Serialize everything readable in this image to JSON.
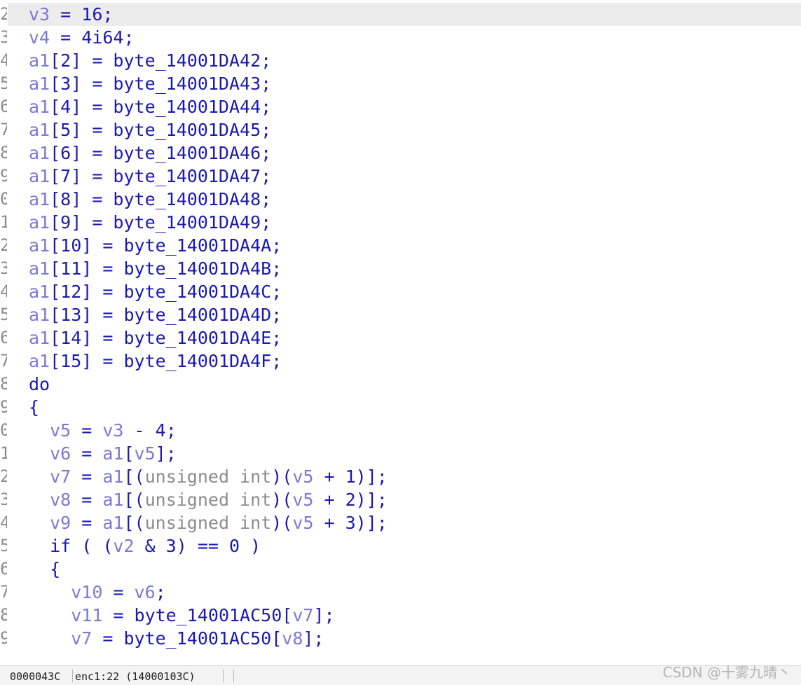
{
  "editor": {
    "lines": [
      {
        "num": "2",
        "tokens": [
          [
            "var",
            "v3"
          ],
          [
            "plain",
            " = 16;"
          ]
        ]
      },
      {
        "num": "3",
        "tokens": [
          [
            "var",
            "v4"
          ],
          [
            "plain",
            " = 4i64;"
          ]
        ]
      },
      {
        "num": "4",
        "tokens": [
          [
            "var",
            "a1"
          ],
          [
            "plain",
            "[2] = byte_14001DA42;"
          ]
        ]
      },
      {
        "num": "5",
        "tokens": [
          [
            "var",
            "a1"
          ],
          [
            "plain",
            "[3] = byte_14001DA43;"
          ]
        ]
      },
      {
        "num": "6",
        "tokens": [
          [
            "var",
            "a1"
          ],
          [
            "plain",
            "[4] = byte_14001DA44;"
          ]
        ]
      },
      {
        "num": "7",
        "tokens": [
          [
            "var",
            "a1"
          ],
          [
            "plain",
            "[5] = byte_14001DA45;"
          ]
        ]
      },
      {
        "num": "8",
        "tokens": [
          [
            "var",
            "a1"
          ],
          [
            "plain",
            "[6] = byte_14001DA46;"
          ]
        ]
      },
      {
        "num": "9",
        "tokens": [
          [
            "var",
            "a1"
          ],
          [
            "plain",
            "[7] = byte_14001DA47;"
          ]
        ]
      },
      {
        "num": "0",
        "tokens": [
          [
            "var",
            "a1"
          ],
          [
            "plain",
            "[8] = byte_14001DA48;"
          ]
        ]
      },
      {
        "num": "1",
        "tokens": [
          [
            "var",
            "a1"
          ],
          [
            "plain",
            "[9] = byte_14001DA49;"
          ]
        ]
      },
      {
        "num": "2",
        "tokens": [
          [
            "var",
            "a1"
          ],
          [
            "plain",
            "[10] = byte_14001DA4A;"
          ]
        ]
      },
      {
        "num": "3",
        "tokens": [
          [
            "var",
            "a1"
          ],
          [
            "plain",
            "[11] = byte_14001DA4B;"
          ]
        ]
      },
      {
        "num": "4",
        "tokens": [
          [
            "var",
            "a1"
          ],
          [
            "plain",
            "[12] = byte_14001DA4C;"
          ]
        ]
      },
      {
        "num": "5",
        "tokens": [
          [
            "var",
            "a1"
          ],
          [
            "plain",
            "[13] = byte_14001DA4D;"
          ]
        ]
      },
      {
        "num": "6",
        "tokens": [
          [
            "var",
            "a1"
          ],
          [
            "plain",
            "[14] = byte_14001DA4E;"
          ]
        ]
      },
      {
        "num": "7",
        "tokens": [
          [
            "var",
            "a1"
          ],
          [
            "plain",
            "[15] = byte_14001DA4F;"
          ]
        ]
      },
      {
        "num": "8",
        "tokens": [
          [
            "plain",
            "do"
          ]
        ]
      },
      {
        "num": "9",
        "tokens": [
          [
            "plain",
            "{"
          ]
        ]
      },
      {
        "num": "0",
        "tokens": [
          [
            "plain",
            "  "
          ],
          [
            "var",
            "v5"
          ],
          [
            "plain",
            " = "
          ],
          [
            "var",
            "v3"
          ],
          [
            "plain",
            " - 4;"
          ]
        ]
      },
      {
        "num": "1",
        "tokens": [
          [
            "plain",
            "  "
          ],
          [
            "var",
            "v6"
          ],
          [
            "plain",
            " = "
          ],
          [
            "var",
            "a1"
          ],
          [
            "plain",
            "["
          ],
          [
            "var",
            "v5"
          ],
          [
            "plain",
            "];"
          ]
        ]
      },
      {
        "num": "2",
        "tokens": [
          [
            "plain",
            "  "
          ],
          [
            "var",
            "v7"
          ],
          [
            "plain",
            " = "
          ],
          [
            "var",
            "a1"
          ],
          [
            "plain",
            "[("
          ],
          [
            "type",
            "unsigned int"
          ],
          [
            "plain",
            ")("
          ],
          [
            "var",
            "v5"
          ],
          [
            "plain",
            " + 1)];"
          ]
        ]
      },
      {
        "num": "3",
        "tokens": [
          [
            "plain",
            "  "
          ],
          [
            "var",
            "v8"
          ],
          [
            "plain",
            " = "
          ],
          [
            "var",
            "a1"
          ],
          [
            "plain",
            "[("
          ],
          [
            "type",
            "unsigned int"
          ],
          [
            "plain",
            ")("
          ],
          [
            "var",
            "v5"
          ],
          [
            "plain",
            " + 2)];"
          ]
        ]
      },
      {
        "num": "4",
        "tokens": [
          [
            "plain",
            "  "
          ],
          [
            "var",
            "v9"
          ],
          [
            "plain",
            " = "
          ],
          [
            "var",
            "a1"
          ],
          [
            "plain",
            "[("
          ],
          [
            "type",
            "unsigned int"
          ],
          [
            "plain",
            ")("
          ],
          [
            "var",
            "v5"
          ],
          [
            "plain",
            " + 3)];"
          ]
        ]
      },
      {
        "num": "5",
        "tokens": [
          [
            "plain",
            "  if ( ("
          ],
          [
            "var",
            "v2"
          ],
          [
            "plain",
            " & 3) == 0 )"
          ]
        ]
      },
      {
        "num": "6",
        "tokens": [
          [
            "plain",
            "  {"
          ]
        ]
      },
      {
        "num": "7",
        "tokens": [
          [
            "plain",
            "    "
          ],
          [
            "var",
            "v10"
          ],
          [
            "plain",
            " = "
          ],
          [
            "var",
            "v6"
          ],
          [
            "plain",
            ";"
          ]
        ]
      },
      {
        "num": "8",
        "tokens": [
          [
            "plain",
            "    "
          ],
          [
            "var",
            "v11"
          ],
          [
            "plain",
            " = byte_14001AC50["
          ],
          [
            "var",
            "v7"
          ],
          [
            "plain",
            "];"
          ]
        ]
      },
      {
        "num": "9",
        "tokens": [
          [
            "plain",
            "    "
          ],
          [
            "var",
            "v7"
          ],
          [
            "plain",
            " = byte_14001AC50["
          ],
          [
            "var",
            "v8"
          ],
          [
            "plain",
            "];"
          ]
        ]
      }
    ]
  },
  "statusbar": {
    "offset": "0000043C",
    "location": "enc1:22 (14000103C)"
  },
  "watermark": "CSDN @十雾九晴丶",
  "colors": {
    "keyword_text": "#1a1ab0",
    "variable": "#7a7ad6",
    "type": "#8c8c8c",
    "current_line_bg": "#ececec"
  }
}
